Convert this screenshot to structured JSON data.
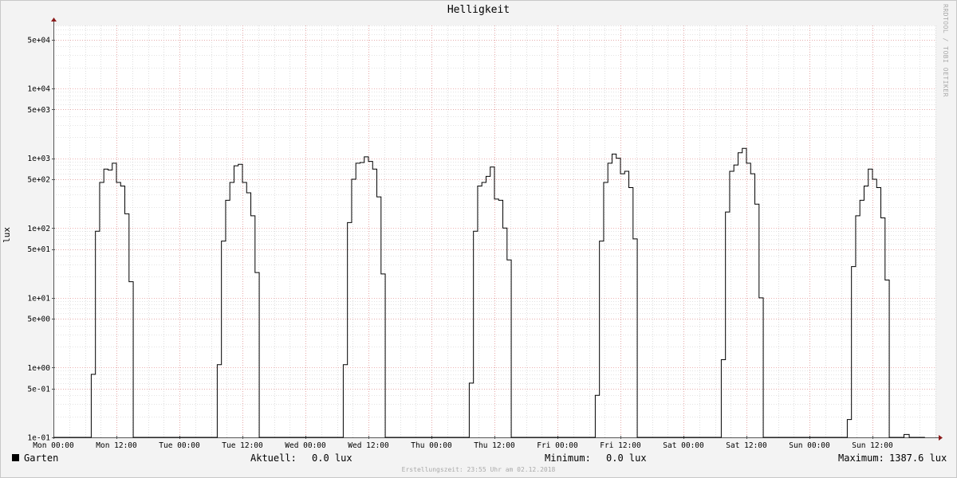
{
  "title": "Helligkeit",
  "watermark": "RRDTOOL / TOBI OETIKER",
  "legend": {
    "series_name": "Garten",
    "current_label": "Aktuell:",
    "current_value": "0.0 lux",
    "min_label": "Minimum:",
    "min_value": "0.0 lux",
    "max_label": "Maximum:",
    "max_value": "1387.6 lux"
  },
  "footer": "Erstellungszeit: 23:55 Uhr am 02.12.2018",
  "colors": {
    "line": "#000000",
    "major_grid": "#e89a9a",
    "minor_grid": "#c8c8c8",
    "background": "#ffffff",
    "canvas": "#f3f3f3",
    "axis": "#8b1a1a"
  },
  "chart_data": {
    "type": "line",
    "title": "Helligkeit",
    "ylabel": "lux",
    "yscale": "log",
    "ylim": [
      0.1,
      80000
    ],
    "xlim_hours": [
      0,
      168
    ],
    "x_tick_labels": [
      "Mon 00:00",
      "Mon 12:00",
      "Tue 00:00",
      "Tue 12:00",
      "Wed 00:00",
      "Wed 12:00",
      "Thu 00:00",
      "Thu 12:00",
      "Fri 00:00",
      "Fri 12:00",
      "Sat 00:00",
      "Sat 12:00",
      "Sun 00:00",
      "Sun 12:00"
    ],
    "x_tick_hours": [
      0,
      12,
      24,
      36,
      48,
      60,
      72,
      84,
      96,
      108,
      120,
      132,
      144,
      156
    ],
    "y_tick_labels": [
      "1e-01",
      "5e-01",
      "1e+00",
      "5e+00",
      "1e+01",
      "5e+01",
      "1e+02",
      "5e+02",
      "1e+03",
      "5e+03",
      "1e+04",
      "5e+04"
    ],
    "y_tick_values": [
      0.1,
      0.5,
      1,
      5,
      10,
      50,
      100,
      500,
      1000,
      5000,
      10000,
      50000
    ],
    "grid": true,
    "legend_position": "bottom",
    "series": [
      {
        "name": "Garten",
        "step": true,
        "points": [
          [
            0,
            0.1
          ],
          [
            7.2,
            0.1
          ],
          [
            7.2,
            0.8
          ],
          [
            8.0,
            0.8
          ],
          [
            8.0,
            90
          ],
          [
            8.8,
            90
          ],
          [
            8.8,
            450
          ],
          [
            9.6,
            450
          ],
          [
            9.6,
            700
          ],
          [
            10.4,
            700
          ],
          [
            10.4,
            680
          ],
          [
            11.2,
            680
          ],
          [
            11.2,
            850
          ],
          [
            12.0,
            850
          ],
          [
            12.0,
            450
          ],
          [
            12.8,
            450
          ],
          [
            12.8,
            400
          ],
          [
            13.6,
            400
          ],
          [
            13.6,
            160
          ],
          [
            14.4,
            160
          ],
          [
            14.4,
            17
          ],
          [
            15.2,
            17
          ],
          [
            15.2,
            0.1
          ],
          [
            31.2,
            0.1
          ],
          [
            31.2,
            1.1
          ],
          [
            32.0,
            1.1
          ],
          [
            32.0,
            65
          ],
          [
            32.8,
            65
          ],
          [
            32.8,
            250
          ],
          [
            33.6,
            250
          ],
          [
            33.6,
            450
          ],
          [
            34.4,
            450
          ],
          [
            34.4,
            780
          ],
          [
            35.2,
            780
          ],
          [
            35.2,
            820
          ],
          [
            36.0,
            820
          ],
          [
            36.0,
            450
          ],
          [
            36.8,
            450
          ],
          [
            36.8,
            320
          ],
          [
            37.6,
            320
          ],
          [
            37.6,
            150
          ],
          [
            38.4,
            150
          ],
          [
            38.4,
            23
          ],
          [
            39.2,
            23
          ],
          [
            39.2,
            0.1
          ],
          [
            55.2,
            0.1
          ],
          [
            55.2,
            1.1
          ],
          [
            56.0,
            1.1
          ],
          [
            56.0,
            120
          ],
          [
            56.8,
            120
          ],
          [
            56.8,
            500
          ],
          [
            57.6,
            500
          ],
          [
            57.6,
            850
          ],
          [
            58.4,
            850
          ],
          [
            58.4,
            870
          ],
          [
            59.2,
            870
          ],
          [
            59.2,
            1050
          ],
          [
            60.0,
            1050
          ],
          [
            60.0,
            900
          ],
          [
            60.8,
            900
          ],
          [
            60.8,
            700
          ],
          [
            61.6,
            700
          ],
          [
            61.6,
            280
          ],
          [
            62.4,
            280
          ],
          [
            62.4,
            22
          ],
          [
            63.2,
            22
          ],
          [
            63.2,
            0.1
          ],
          [
            79.2,
            0.1
          ],
          [
            79.2,
            0.6
          ],
          [
            80.0,
            0.6
          ],
          [
            80.0,
            90
          ],
          [
            80.8,
            90
          ],
          [
            80.8,
            400
          ],
          [
            81.6,
            400
          ],
          [
            81.6,
            450
          ],
          [
            82.4,
            450
          ],
          [
            82.4,
            550
          ],
          [
            83.2,
            550
          ],
          [
            83.2,
            750
          ],
          [
            84.0,
            750
          ],
          [
            84.0,
            260
          ],
          [
            84.8,
            260
          ],
          [
            84.8,
            250
          ],
          [
            85.6,
            250
          ],
          [
            85.6,
            100
          ],
          [
            86.4,
            100
          ],
          [
            86.4,
            35
          ],
          [
            87.2,
            35
          ],
          [
            87.2,
            0.1
          ],
          [
            103.2,
            0.1
          ],
          [
            103.2,
            0.4
          ],
          [
            104.0,
            0.4
          ],
          [
            104.0,
            65
          ],
          [
            104.8,
            65
          ],
          [
            104.8,
            450
          ],
          [
            105.6,
            450
          ],
          [
            105.6,
            850
          ],
          [
            106.4,
            850
          ],
          [
            106.4,
            1150
          ],
          [
            107.2,
            1150
          ],
          [
            107.2,
            1000
          ],
          [
            108.0,
            1000
          ],
          [
            108.0,
            600
          ],
          [
            108.8,
            600
          ],
          [
            108.8,
            650
          ],
          [
            109.6,
            650
          ],
          [
            109.6,
            380
          ],
          [
            110.4,
            380
          ],
          [
            110.4,
            70
          ],
          [
            111.2,
            70
          ],
          [
            111.2,
            0.1
          ],
          [
            127.2,
            0.1
          ],
          [
            127.2,
            1.3
          ],
          [
            128.0,
            1.3
          ],
          [
            128.0,
            170
          ],
          [
            128.8,
            170
          ],
          [
            128.8,
            650
          ],
          [
            129.6,
            650
          ],
          [
            129.6,
            800
          ],
          [
            130.4,
            800
          ],
          [
            130.4,
            1200
          ],
          [
            131.2,
            1200
          ],
          [
            131.2,
            1387.6
          ],
          [
            132.0,
            1387.6
          ],
          [
            132.0,
            850
          ],
          [
            132.8,
            850
          ],
          [
            132.8,
            600
          ],
          [
            133.6,
            600
          ],
          [
            133.6,
            220
          ],
          [
            134.4,
            220
          ],
          [
            134.4,
            10
          ],
          [
            135.2,
            10
          ],
          [
            135.2,
            0.1
          ],
          [
            151.2,
            0.1
          ],
          [
            151.2,
            0.18
          ],
          [
            152.0,
            0.18
          ],
          [
            152.0,
            28
          ],
          [
            152.8,
            28
          ],
          [
            152.8,
            150
          ],
          [
            153.6,
            150
          ],
          [
            153.6,
            250
          ],
          [
            154.4,
            250
          ],
          [
            154.4,
            400
          ],
          [
            155.2,
            400
          ],
          [
            155.2,
            700
          ],
          [
            156.0,
            700
          ],
          [
            156.0,
            500
          ],
          [
            156.8,
            500
          ],
          [
            156.8,
            380
          ],
          [
            157.6,
            380
          ],
          [
            157.6,
            140
          ],
          [
            158.4,
            140
          ],
          [
            158.4,
            18
          ],
          [
            159.2,
            18
          ],
          [
            159.2,
            0.1
          ],
          [
            162.0,
            0.1
          ],
          [
            162.0,
            0.11
          ],
          [
            163.0,
            0.11
          ],
          [
            163.0,
            0.1
          ],
          [
            166.0,
            0.1
          ]
        ]
      }
    ]
  }
}
